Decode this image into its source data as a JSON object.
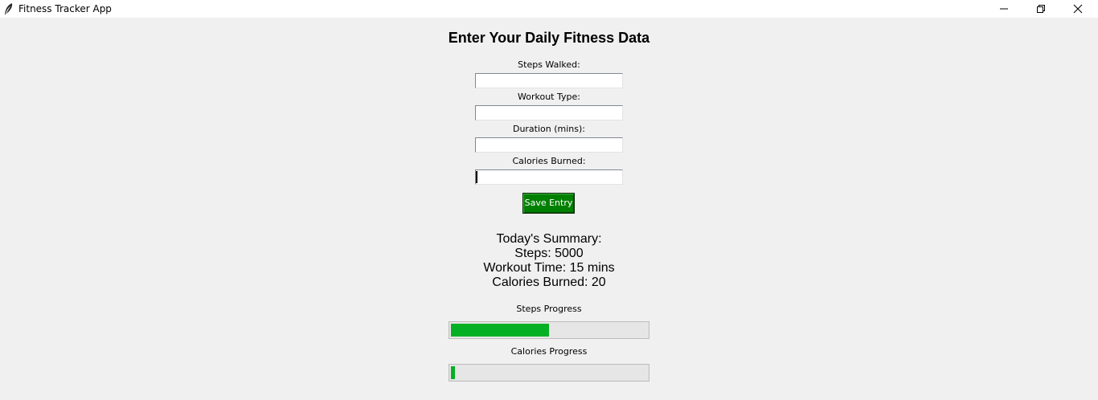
{
  "window": {
    "title": "Fitness Tracker App",
    "icon": "feather-icon"
  },
  "form": {
    "title": "Enter Your Daily Fitness Data",
    "steps_label": "Steps Walked:",
    "steps_value": "",
    "workout_label": "Workout Type:",
    "workout_value": "",
    "duration_label": "Duration (mins):",
    "duration_value": "",
    "calories_label": "Calories Burned:",
    "calories_value": "",
    "save_label": "Save Entry"
  },
  "summary": {
    "heading": "Today's Summary:",
    "steps": "Steps: 5000",
    "workout_time": "Workout Time: 15 mins",
    "calories": "Calories Burned: 20"
  },
  "progress": {
    "steps_label": "Steps Progress",
    "steps_fraction": 0.5,
    "calories_label": "Calories Progress",
    "calories_fraction": 0.02
  },
  "colors": {
    "save_button": "#008000",
    "progress_fill": "#06b025",
    "background": "#f0f0f0"
  }
}
